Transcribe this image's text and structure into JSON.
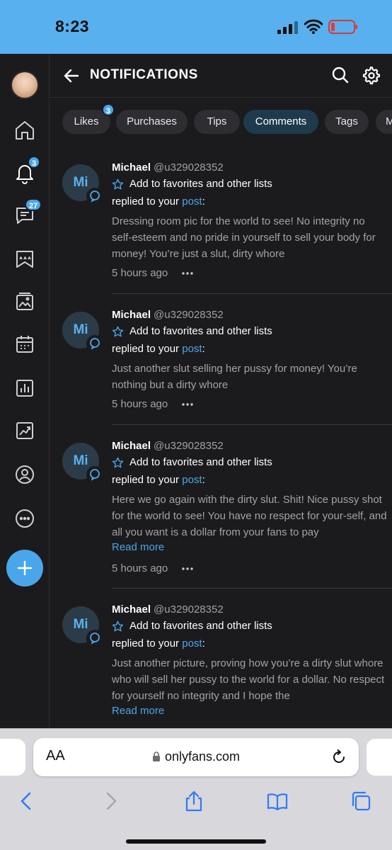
{
  "status_bar": {
    "time": "8:23"
  },
  "sidebar": {
    "items": [
      {
        "name": "home-icon"
      },
      {
        "name": "bell-icon",
        "badge": "3"
      },
      {
        "name": "messages-icon",
        "badge": "27"
      },
      {
        "name": "collections-icon"
      },
      {
        "name": "vault-icon"
      },
      {
        "name": "calendar-icon"
      },
      {
        "name": "statistics-icon"
      },
      {
        "name": "analytics-icon"
      },
      {
        "name": "profile-icon"
      },
      {
        "name": "more-icon"
      }
    ],
    "add_icon": "plus-icon"
  },
  "header": {
    "title": "NOTIFICATIONS"
  },
  "tabs": [
    {
      "label": "Likes",
      "badge": "3"
    },
    {
      "label": "Purchases"
    },
    {
      "label": "Tips"
    },
    {
      "label": "Comments",
      "active": true
    },
    {
      "label": "Tags"
    },
    {
      "label": "M"
    }
  ],
  "notifications": [
    {
      "initials": "Mi",
      "name": "Michael",
      "handle": "@u329028352",
      "fav": "Add to favorites and other lists",
      "reply_prefix": "replied to your",
      "post_link": "post",
      "reply_suffix": ":",
      "comment": "Dressing room pic for the world to see! No integrity no self-esteem and no pride in yourself to sell your body for money! You’re just a slut, dirty whore",
      "time": "5 hours ago"
    },
    {
      "initials": "Mi",
      "name": "Michael",
      "handle": "@u329028352",
      "fav": "Add to favorites and other lists",
      "reply_prefix": "replied to your",
      "post_link": "post",
      "reply_suffix": ":",
      "comment": "Just another slut selling her pussy for money! You’re nothing but a dirty whore",
      "time": "5 hours ago"
    },
    {
      "initials": "Mi",
      "name": "Michael",
      "handle": "@u329028352",
      "fav": "Add to favorites and other lists",
      "reply_prefix": "replied to your",
      "post_link": "post",
      "reply_suffix": ":",
      "comment": "Here we go again with the dirty slut. Shit! Nice pussy shot for the world to see! You have no respect for your-self, and all you want is a dollar from your fans to pay",
      "read_more": "Read more",
      "time": "5 hours ago"
    },
    {
      "initials": "Mi",
      "name": "Michael",
      "handle": "@u329028352",
      "fav": "Add to favorites and other lists",
      "reply_prefix": "replied to your",
      "post_link": "post",
      "reply_suffix": ":",
      "comment": "Just another picture, proving how you’re a dirty slut whore who will sell her pussy to the world for a dollar. No respect for yourself no integrity and I hope the",
      "read_more": "Read more"
    }
  ],
  "browser": {
    "text_size_label": "AA",
    "url": "onlyfans.com"
  },
  "colors": {
    "accent": "#4aa6ea",
    "background": "#1b1b1d",
    "status_bar": "#59b0ee"
  }
}
